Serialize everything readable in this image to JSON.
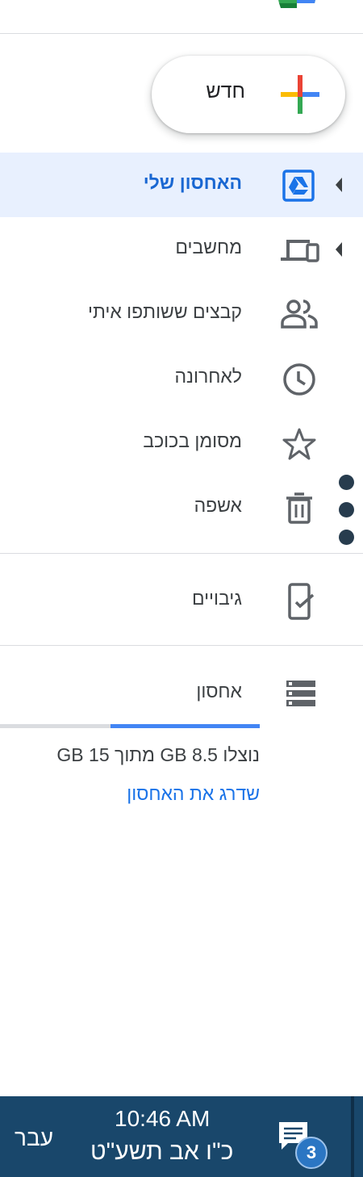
{
  "new_button": {
    "label": "חדש"
  },
  "nav": {
    "items": [
      {
        "label": "האחסון שלי",
        "icon": "drive-icon",
        "active": true,
        "has_arrow": true
      },
      {
        "label": "מחשבים",
        "icon": "computers-icon",
        "active": false,
        "has_arrow": true
      },
      {
        "label": "קבצים ששותפו איתי",
        "icon": "shared-people-icon",
        "active": false,
        "has_arrow": false
      },
      {
        "label": "לאחרונה",
        "icon": "clock-icon",
        "active": false,
        "has_arrow": false
      },
      {
        "label": "מסומן בכוכב",
        "icon": "star-icon",
        "active": false,
        "has_arrow": false
      },
      {
        "label": "אשפה",
        "icon": "trash-icon",
        "active": false,
        "has_arrow": false
      }
    ],
    "backups": {
      "label": "גיבויים",
      "icon": "backup-phone-icon"
    }
  },
  "storage": {
    "label": "אחסון",
    "usage_text": "נוצלו 8.5 GB מתוך 15 GB",
    "used_gb": 8.5,
    "total_gb": 15,
    "upgrade_label": "שדרג את האחסון"
  },
  "taskbar": {
    "time": "10:46 AM",
    "date": "כ\"ו אב תשע\"ט",
    "language": "עבר",
    "notification_count": "3"
  },
  "colors": {
    "accent": "#1a73e8",
    "active_bg": "#e8f0fe",
    "active_text": "#1967d2",
    "taskbar_bg": "#19476b"
  }
}
